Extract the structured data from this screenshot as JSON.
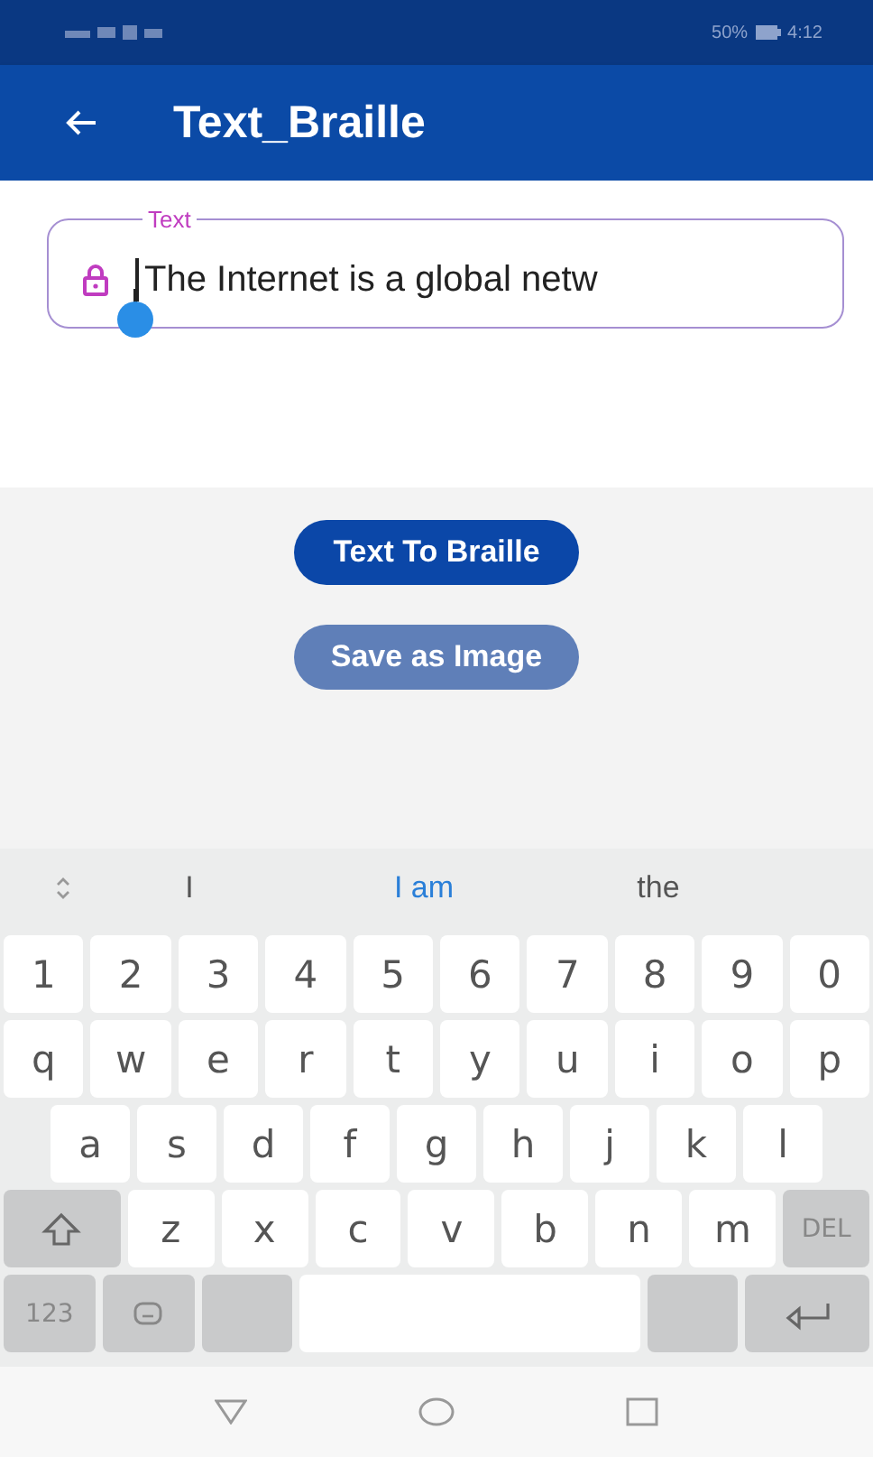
{
  "status_bar": {
    "battery": "50%",
    "time": "4:12"
  },
  "app_bar": {
    "title": "Text_Braille"
  },
  "text_field": {
    "label": "Text",
    "value": "The Internet is a global netw",
    "focused": true
  },
  "buttons": [
    {
      "label": "Text To Braille",
      "disabled": false
    },
    {
      "label": "Save as Image",
      "disabled": true
    }
  ],
  "suggestions": [
    {
      "text": "I",
      "selected": false
    },
    {
      "text": "I am",
      "selected": true
    },
    {
      "text": "the",
      "selected": false
    }
  ],
  "keyboard_rows": [
    [
      {
        "kind": "char",
        "label": "1"
      },
      {
        "kind": "char",
        "label": "2"
      },
      {
        "kind": "char",
        "label": "3"
      },
      {
        "kind": "char",
        "label": "4"
      },
      {
        "kind": "char",
        "label": "5"
      },
      {
        "kind": "char",
        "label": "6"
      },
      {
        "kind": "char",
        "label": "7"
      },
      {
        "kind": "char",
        "label": "8"
      },
      {
        "kind": "char",
        "label": "9"
      },
      {
        "kind": "char",
        "label": "0"
      }
    ],
    [
      {
        "kind": "char",
        "label": "q"
      },
      {
        "kind": "char",
        "label": "w"
      },
      {
        "kind": "char",
        "label": "e"
      },
      {
        "kind": "char",
        "label": "r"
      },
      {
        "kind": "char",
        "label": "t"
      },
      {
        "kind": "char",
        "label": "y"
      },
      {
        "kind": "char",
        "label": "u"
      },
      {
        "kind": "char",
        "label": "i"
      },
      {
        "kind": "char",
        "label": "o"
      },
      {
        "kind": "char",
        "label": "p"
      }
    ],
    [
      {
        "kind": "char",
        "label": "a"
      },
      {
        "kind": "char",
        "label": "s"
      },
      {
        "kind": "char",
        "label": "d"
      },
      {
        "kind": "char",
        "label": "f"
      },
      {
        "kind": "char",
        "label": "g"
      },
      {
        "kind": "char",
        "label": "h"
      },
      {
        "kind": "char",
        "label": "j"
      },
      {
        "kind": "char",
        "label": "k"
      },
      {
        "kind": "char",
        "label": "l"
      }
    ],
    [
      {
        "kind": "shift"
      },
      {
        "kind": "char",
        "label": "z"
      },
      {
        "kind": "char",
        "label": "x"
      },
      {
        "kind": "char",
        "label": "c"
      },
      {
        "kind": "char",
        "label": "v"
      },
      {
        "kind": "char",
        "label": "b"
      },
      {
        "kind": "char",
        "label": "n"
      },
      {
        "kind": "char",
        "label": "m"
      },
      {
        "kind": "function",
        "label": "DEL"
      }
    ],
    [
      {
        "kind": "function",
        "label": "123"
      },
      {
        "kind": "emoji"
      },
      {
        "kind": "blank"
      },
      {
        "kind": "space"
      },
      {
        "kind": "blank"
      },
      {
        "kind": "enter"
      }
    ]
  ]
}
